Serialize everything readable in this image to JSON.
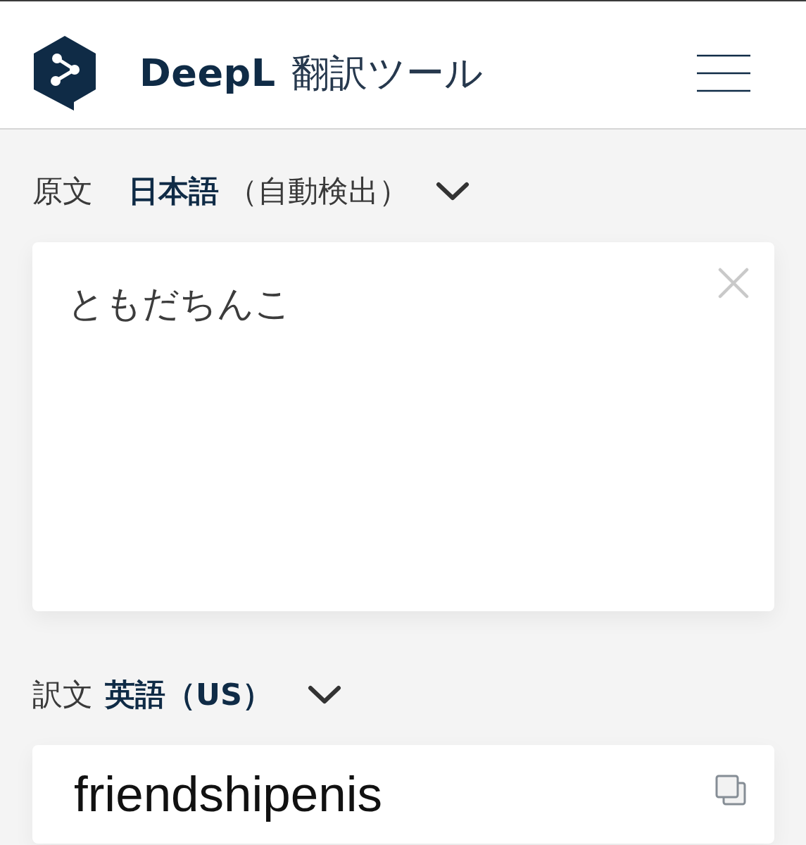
{
  "header": {
    "brand": "DeepL",
    "title": "翻訳ツール"
  },
  "source": {
    "label": "原文",
    "language": "日本語",
    "detection": "（自動検出）",
    "text": "ともだちんこ"
  },
  "target": {
    "label": "訳文",
    "language": "英語（US）",
    "text": "friendshipenis"
  }
}
